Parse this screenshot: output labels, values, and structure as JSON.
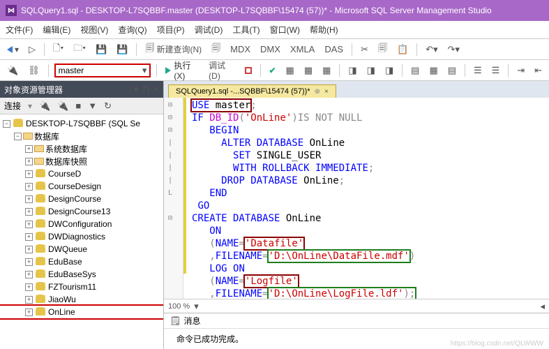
{
  "title": "SQLQuery1.sql - DESKTOP-L7SQBBF.master (DESKTOP-L7SQBBF\\15474 (57))* - Microsoft SQL Server Management Studio",
  "menubar": {
    "file": "文件(F)",
    "edit": "编辑(E)",
    "view": "视图(V)",
    "query": "查询(Q)",
    "project": "项目(P)",
    "debug": "调试(D)",
    "tools": "工具(T)",
    "window": "窗口(W)",
    "help": "帮助(H)"
  },
  "toolbar": {
    "new_query": "新建查询(N)",
    "execute": "执行(X)",
    "debug": "调试(D)"
  },
  "db_selector": {
    "value": "master"
  },
  "panel": {
    "title": "对象资源管理器",
    "connect": "连接"
  },
  "tree": {
    "server": "DESKTOP-L7SQBBF (SQL Se",
    "databases": "数据库",
    "sysdb": "系统数据库",
    "snapshot": "数据库快照",
    "items": [
      "CourseD",
      "CourseDesign",
      "DesignCourse",
      "DesignCourse13",
      "DWConfiguration",
      "DWDiagnostics",
      "DWQueue",
      "EduBase",
      "EduBaseSys",
      "FZTourism11",
      "JiaoWu",
      "OnLine"
    ]
  },
  "tab": {
    "label": "SQLQuery1.sql -...SQBBF\\15474 (57))*"
  },
  "code": {
    "l1a": "USE",
    "l1b": " master",
    "l1c": ";",
    "l2a": "IF",
    "l2b": " DB_ID",
    "l2c": "(",
    "l2d": "'OnLine'",
    "l2e": ")",
    "l2f": "IS NOT NULL",
    "l3": "BEGIN",
    "l4a": "ALTER DATABASE",
    "l4b": " OnLine",
    "l5a": "SET",
    "l5b": " SINGLE_USER",
    "l6a": "WITH ROLLBACK IMMEDIATE",
    "l6c": ";",
    "l7a": "DROP DATABASE",
    "l7b": " OnLine",
    "l7c": ";",
    "l8": "END",
    "l9": "GO",
    "l10a": "CREATE DATABASE",
    "l10b": " OnLine",
    "l11": "ON",
    "l12a": "(",
    "l12b": "NAME",
    "l12c": "=",
    "l12d": "'Datafile'",
    "l13a": ",",
    "l13b": "FILENAME",
    "l13c": "=",
    "l13d": "'D:\\OnLine\\DataFile.mdf'",
    "l13e": ")",
    "l14a": "LOG",
    "l14b": " ON",
    "l15a": "(",
    "l15b": "NAME",
    "l15c": "=",
    "l15d": "'Logfile'",
    "l16a": ",",
    "l16b": "FILENAME",
    "l16c": "=",
    "l16d": "'D:\\OnLine\\LogFile.ldf'",
    "l16e": ")",
    "l16f": ";"
  },
  "zoom": "100 %",
  "messages": {
    "tab": "消息",
    "body": "命令已成功完成。"
  },
  "watermark": "https://blog.csdn.net/QLWWW"
}
